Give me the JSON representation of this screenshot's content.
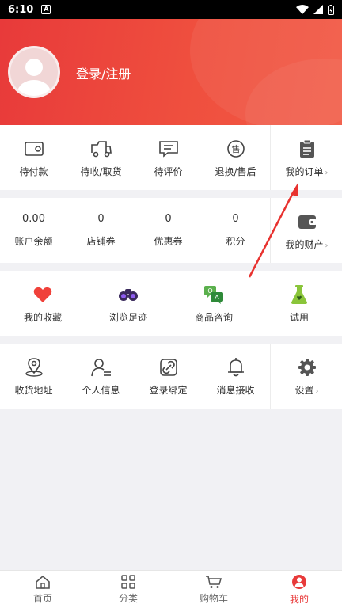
{
  "status_bar": {
    "time": "6:10",
    "notification_badge": "A"
  },
  "header": {
    "login_label": "登录/注册"
  },
  "orders": {
    "items": [
      {
        "label": "待付款",
        "icon": "wallet-icon"
      },
      {
        "label": "待收/取货",
        "icon": "truck-icon"
      },
      {
        "label": "待评价",
        "icon": "comment-icon"
      },
      {
        "label": "退换/售后",
        "icon": "after-sale-icon"
      }
    ],
    "side": {
      "label": "我的订单",
      "icon": "clipboard-icon"
    }
  },
  "assets": {
    "items": [
      {
        "value": "0.00",
        "label": "账户余额"
      },
      {
        "value": "0",
        "label": "店铺券"
      },
      {
        "value": "0",
        "label": "优惠券"
      },
      {
        "value": "0",
        "label": "积分"
      }
    ],
    "side": {
      "label": "我的财产",
      "icon": "purse-icon"
    }
  },
  "services": {
    "items": [
      {
        "label": "我的收藏",
        "icon": "heart-icon"
      },
      {
        "label": "浏览足迹",
        "icon": "binoculars-icon"
      },
      {
        "label": "商品咨询",
        "icon": "chat-icon"
      },
      {
        "label": "试用",
        "icon": "flask-icon"
      }
    ]
  },
  "settings": {
    "items": [
      {
        "label": "收货地址",
        "icon": "location-icon"
      },
      {
        "label": "个人信息",
        "icon": "user-info-icon"
      },
      {
        "label": "登录绑定",
        "icon": "link-icon"
      },
      {
        "label": "消息接收",
        "icon": "bell-icon"
      }
    ],
    "side": {
      "label": "设置",
      "icon": "gear-icon"
    }
  },
  "tabbar": {
    "items": [
      {
        "label": "首页",
        "icon": "home-icon"
      },
      {
        "label": "分类",
        "icon": "category-icon"
      },
      {
        "label": "购物车",
        "icon": "cart-icon"
      },
      {
        "label": "我的",
        "icon": "profile-icon"
      }
    ],
    "active": "我的"
  },
  "colors": {
    "brand": "#e83a3a",
    "header_gradient_end": "#f25a45",
    "background": "#f1f1f4"
  }
}
